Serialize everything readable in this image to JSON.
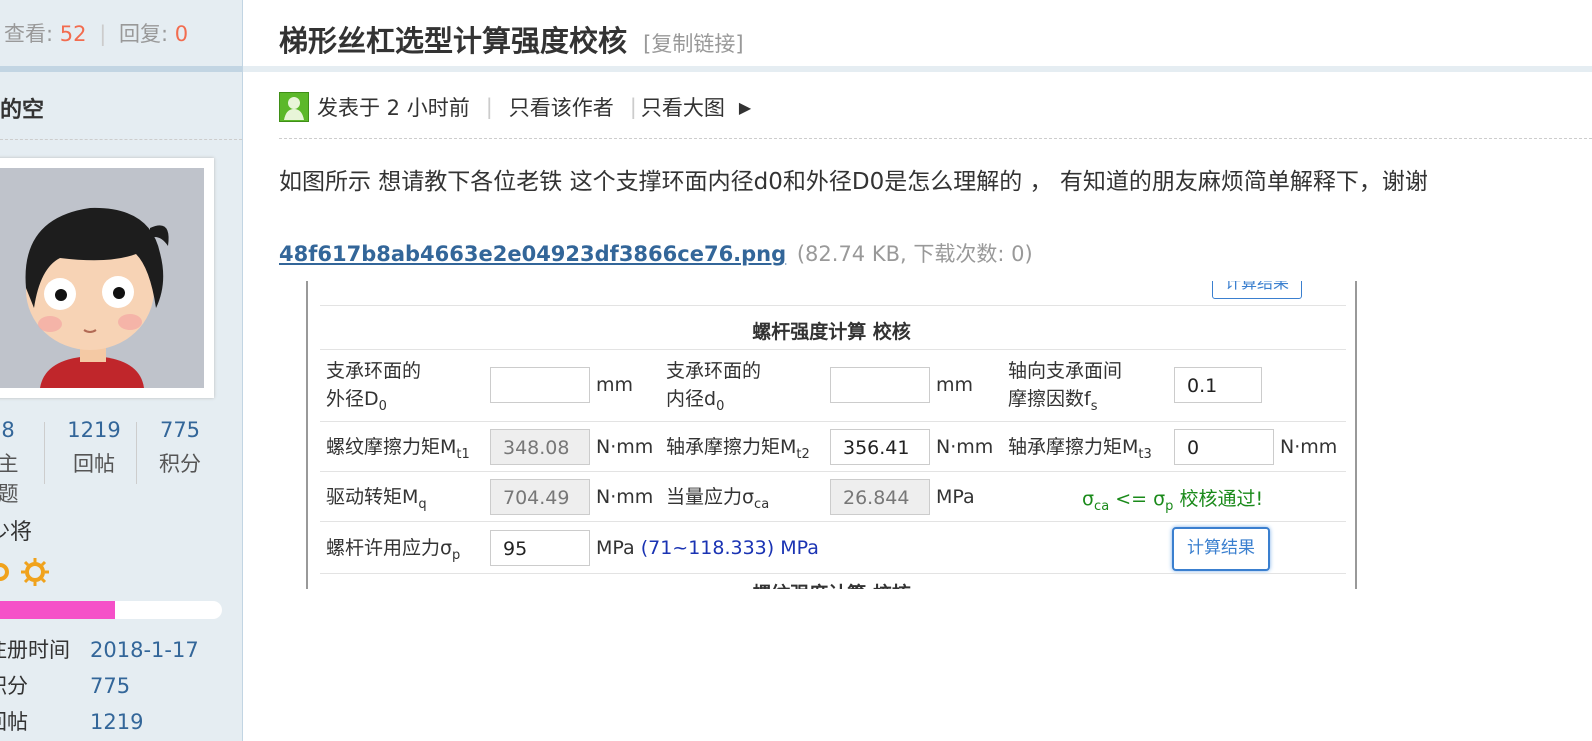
{
  "sidebar": {
    "views_label": "查看:",
    "views": "52",
    "replies_label": "回复:",
    "replies": "0",
    "author": "空的空",
    "stats": [
      {
        "value": "8",
        "label": "主题"
      },
      {
        "value": "1219",
        "label": "回帖"
      },
      {
        "value": "775",
        "label": "积分"
      }
    ],
    "rank": "少将",
    "progress_fraction": 0.54,
    "progress_color": "#f550c8",
    "info": [
      {
        "key": "注册时间",
        "value": "2018-1-17"
      },
      {
        "key": "积分",
        "value": "775"
      },
      {
        "key": "回帖",
        "value": "1219"
      }
    ]
  },
  "thread": {
    "title": "梯形丝杠选型计算强度校核",
    "copy_link": "[复制链接]",
    "posted": "发表于 2 小时前",
    "only_author": "只看该作者",
    "only_big_image": "只看大图",
    "body": "如图所示 想请教下各位老铁 这个支撑环面内径d0和外径D0是怎么理解的 ， 有知道的朋友麻烦简单解释下，谢谢",
    "attachment_name": "48f617b8ab4663e2e04923df3866ce76.png",
    "attachment_meta": "(82.74 KB, 下载次数: 0)"
  },
  "calc": {
    "top_button": "计算结果",
    "title": "螺杆强度计算 校核",
    "row1": {
      "label1_line1": "支承环面的",
      "label1_line2": "外径D",
      "label1_sub": "0",
      "value1": "",
      "unit1": "mm",
      "label2_line1": "支承环面的",
      "label2_line2": "内径d",
      "label2_sub": "0",
      "value2": "",
      "unit2": "mm",
      "label3_line1": "轴向支承面间",
      "label3_line2": "摩擦因数f",
      "label3_sub": "s",
      "value3": "0.1"
    },
    "row2": {
      "label1": "螺纹摩擦力矩M",
      "label1_sub": "t1",
      "value1": "348.08",
      "unit1": "N·mm",
      "label2": "轴承摩擦力矩M",
      "label2_sub": "t2",
      "value2": "356.41",
      "unit2": "N·mm",
      "label3": "轴承摩擦力矩M",
      "label3_sub": "t3",
      "value3": "0",
      "unit3": "N·mm"
    },
    "row3": {
      "label1": "驱动转矩M",
      "label1_sub": "q",
      "value1": "704.49",
      "unit1": "N·mm",
      "label2": "当量应力σ",
      "label2_sub": "ca",
      "value2": "26.844",
      "unit2": "MPa",
      "pass_sigma": "σ",
      "pass_sub1": "ca",
      "pass_op": " <= σ",
      "pass_sub2": "p",
      "pass_text": " 校核通过!"
    },
    "row4": {
      "label1": "螺杆许用应力σ",
      "label1_sub": "p",
      "value1": "95",
      "unit1": "MPa",
      "range": "(71~118.333) MPa",
      "button": "计算结果"
    },
    "cut_title": "螺纹强度计算 校核"
  }
}
